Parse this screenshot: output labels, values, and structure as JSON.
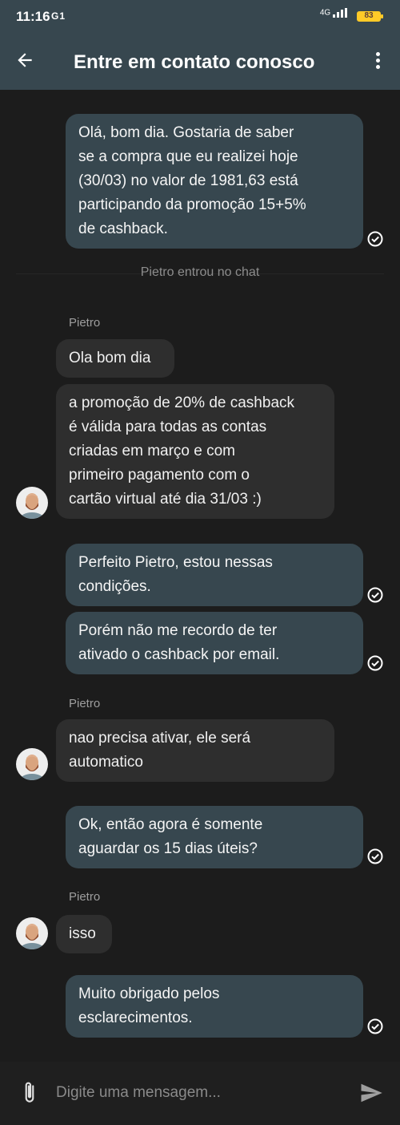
{
  "status_bar": {
    "time": "11:16",
    "indicators": "G1",
    "signal": "4G",
    "battery": "83"
  },
  "header": {
    "title": "Entre em contato conosco",
    "back_icon": "arrow-back-icon",
    "menu_icon": "more-vert-icon"
  },
  "messages": [
    {
      "type": "out",
      "text": "Olá, bom dia. Gostaria de saber\nse a compra que eu realizei hoje\n(30/03) no valor de 1981,63 está\nparticipando da promoção 15+5%\nde cashback."
    },
    {
      "type": "system",
      "text": "Pietro entrou no chat"
    },
    {
      "type": "sender",
      "text": "Pietro"
    },
    {
      "type": "in",
      "text": "Ola bom dia"
    },
    {
      "type": "in",
      "text": "a promoção de 20% de cashback\né válida para todas as contas\ncriadas em março e com\nprimeiro pagamento com o\ncartão virtual até dia 31/03 :)"
    },
    {
      "type": "out",
      "text": "Perfeito Pietro, estou nessas\ncondições."
    },
    {
      "type": "out",
      "text": "Porém não me recordo de ter\nativado o cashback por email."
    },
    {
      "type": "sender",
      "text": "Pietro"
    },
    {
      "type": "in",
      "text": "nao precisa ativar, ele será\nautomatico"
    },
    {
      "type": "out",
      "text": "Ok, então agora é somente\naguardar os 15 dias úteis?"
    },
    {
      "type": "sender",
      "text": "Pietro"
    },
    {
      "type": "in",
      "text": "isso"
    },
    {
      "type": "out",
      "text": "Muito obrigado pelos\nesclarecimentos."
    }
  ],
  "composer": {
    "placeholder": "Digite uma mensagem...",
    "attach_icon": "paperclip-icon",
    "send_icon": "send-icon"
  },
  "colors": {
    "header_bg": "#37474f",
    "chat_bg": "#1c1c1c",
    "outgoing_bubble": "#37474f",
    "incoming_bubble": "#2e2e2e",
    "battery": "#ffca28"
  }
}
